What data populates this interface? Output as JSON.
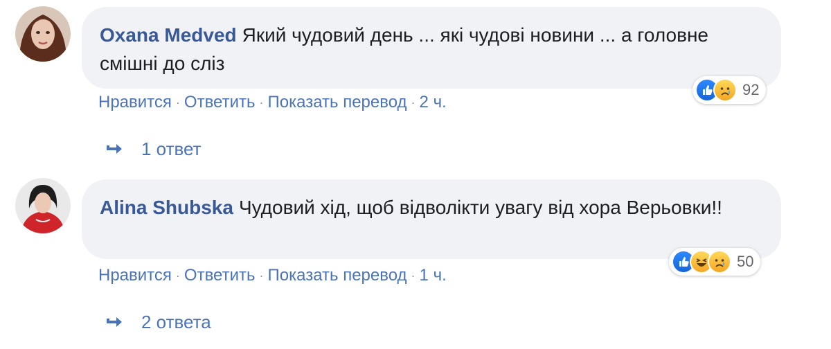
{
  "comments": [
    {
      "author": "Oxana Medved",
      "text": "Який чудовий день ... які чудові новини ... а головне смішні до сліз",
      "reaction_count": "92",
      "reactions": [
        "like",
        "sad"
      ],
      "actions": {
        "like": "Нравится",
        "reply": "Ответить",
        "translate": "Показать перевод",
        "time": "2 ч."
      },
      "replies_label": "1 ответ"
    },
    {
      "author": "Alina Shubska",
      "text": "Чудовий хід, щоб відволікти увагу від хора Верьовки!!",
      "reaction_count": "50",
      "reactions": [
        "like",
        "haha",
        "sad"
      ],
      "actions": {
        "like": "Нравится",
        "reply": "Ответить",
        "translate": "Показать перевод",
        "time": "1 ч."
      },
      "replies_label": "2 ответа"
    }
  ],
  "colors": {
    "link": "#385898",
    "action": "#4b74b8",
    "bubble": "#f0f2f5",
    "like": "#1877f2"
  }
}
